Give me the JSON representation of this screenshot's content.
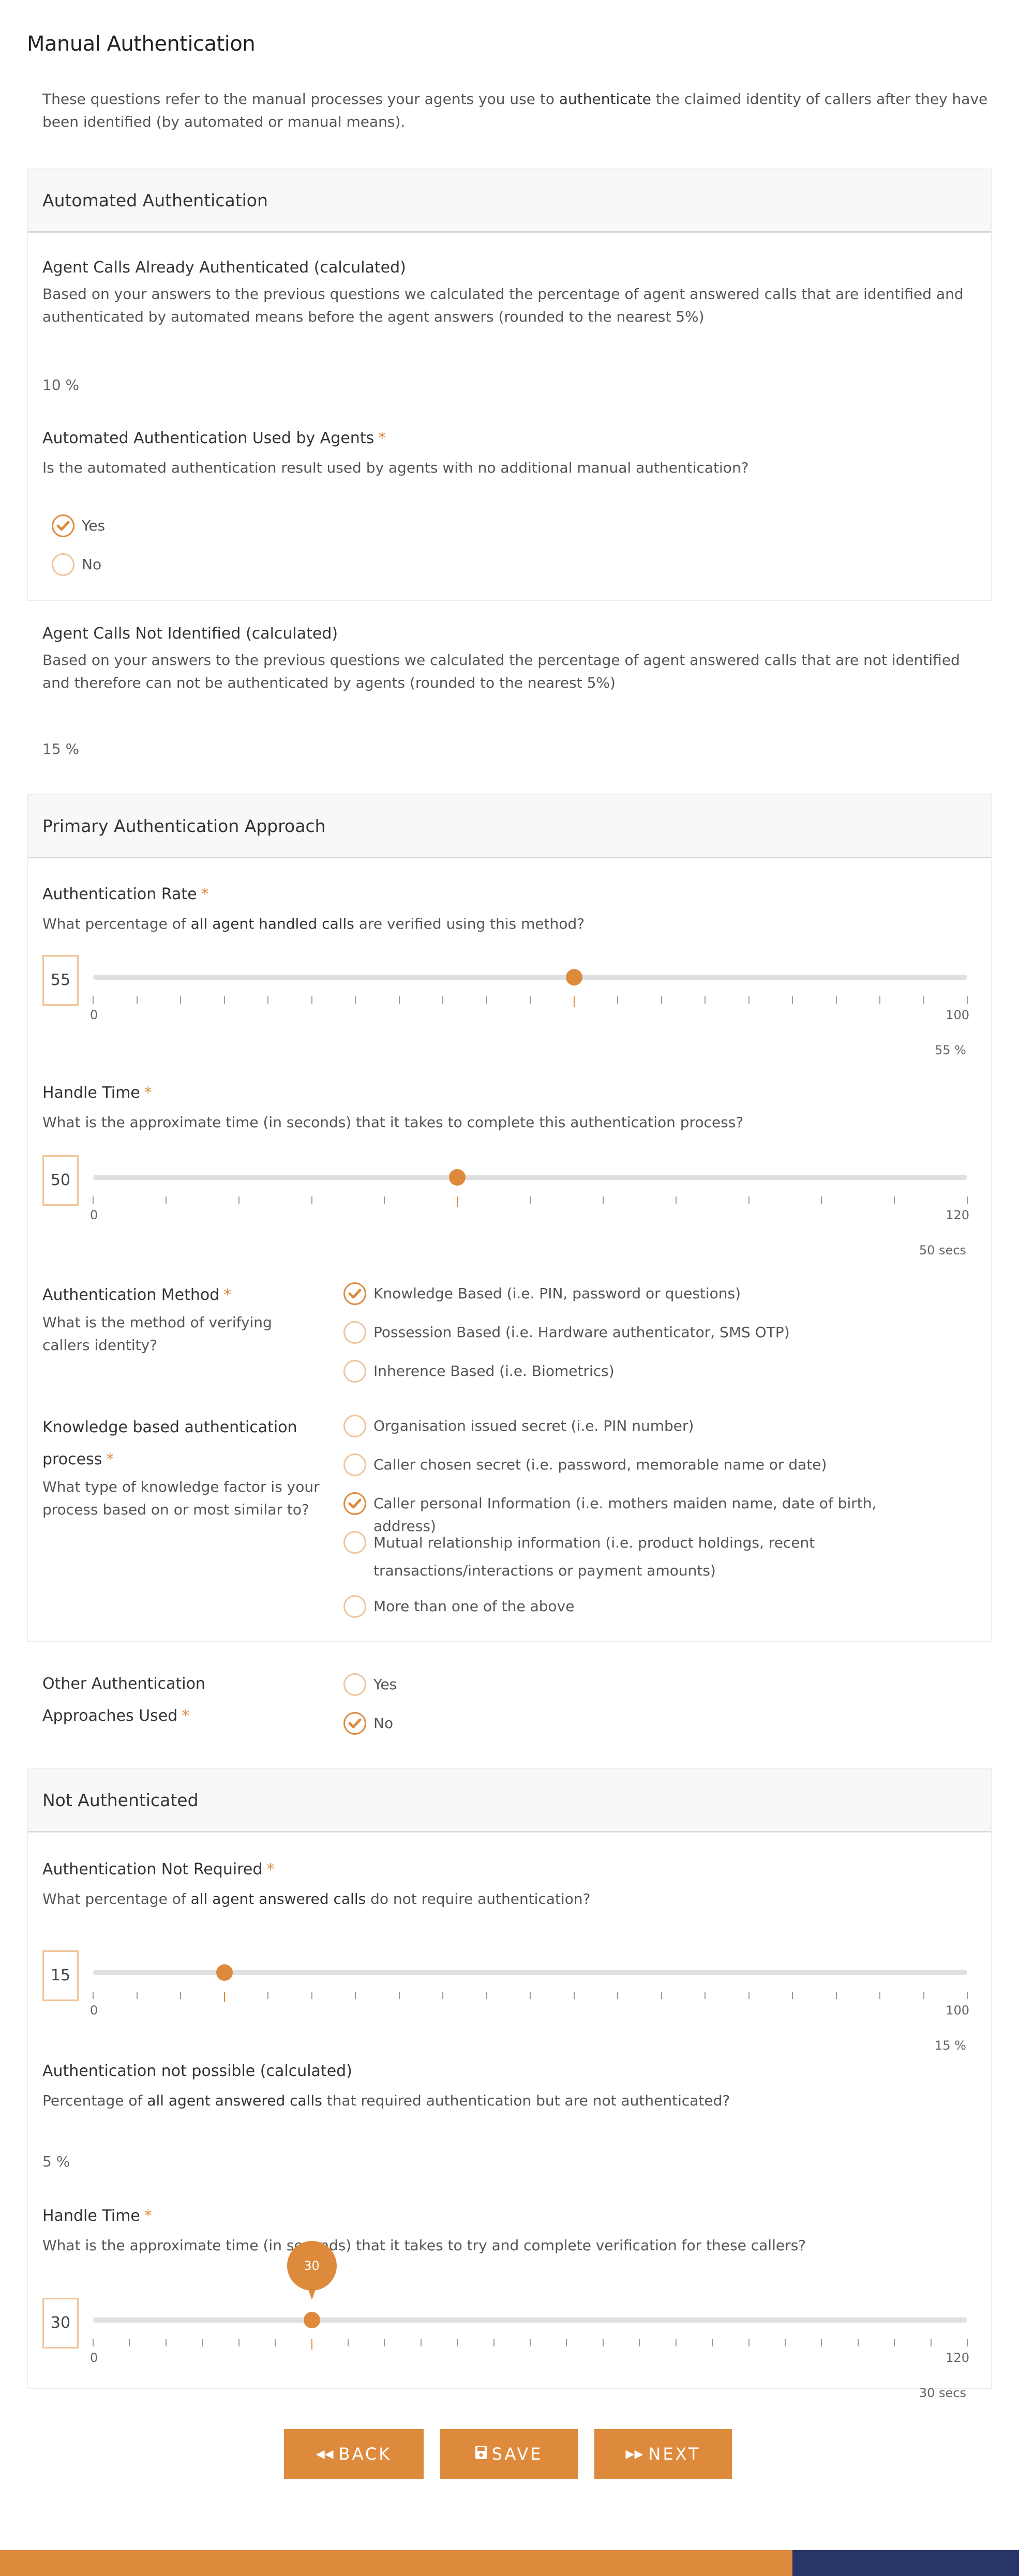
{
  "page": {
    "title": "Manual Authentication",
    "intro_pre": "These questions refer to the manual processes your agents you use to ",
    "intro_bold": "authenticate",
    "intro_post": " the claimed identity of callers after they have been identified (by automated or manual means)."
  },
  "colors": {
    "accent": "#de8a3c",
    "accent_light": "#f0c49a",
    "footer_navy": "#283568",
    "panel_header_bg": "#f8f8f8"
  },
  "automated": {
    "header": "Automated Authentication",
    "already_auth": {
      "title": "Agent Calls Already Authenticated (calculated)",
      "desc": "Based on your answers to the previous questions we calculated the percentage of agent answered calls that are identified and authenticated by automated means before the agent answers (rounded to the nearest 5%)",
      "value": "10 %"
    },
    "used_by_agents": {
      "title": "Automated Authentication Used by Agents",
      "required": "*",
      "desc": "Is the automated authentication result used by agents with no additional manual authentication?",
      "options": [
        {
          "label": "Yes",
          "checked": true
        },
        {
          "label": "No",
          "checked": false
        }
      ]
    }
  },
  "not_identified": {
    "title": "Agent Calls Not Identified (calculated)",
    "desc": "Based on your answers to the previous questions we calculated the percentage of agent answered calls that are not identified and therefore can not be authenticated by agents (rounded to the nearest 5%)",
    "value": "15 %"
  },
  "primary": {
    "header": "Primary Authentication Approach",
    "auth_rate": {
      "title": "Authentication Rate",
      "required": "*",
      "desc_pre": "What percentage of ",
      "desc_bold": "all agent handled calls",
      "desc_post": " are verified using this method?",
      "value": 55,
      "min": 0,
      "max": 100,
      "step": 5,
      "min_label": "0",
      "max_label": "100",
      "readout": "55 %"
    },
    "handle_time": {
      "title": "Handle Time",
      "required": "*",
      "desc": "What is the approximate time (in seconds) that it takes to complete this authentication process?",
      "value": 50,
      "min": 0,
      "max": 120,
      "step": 10,
      "min_label": "0",
      "max_label": "120",
      "readout": "50 secs"
    },
    "method": {
      "title": "Authentication Method",
      "required": "*",
      "desc": "What is the method of verifying callers identity?",
      "options": [
        {
          "label": "Knowledge Based (i.e. PIN, password or questions)",
          "checked": true
        },
        {
          "label": "Possession Based (i.e. Hardware authenticator, SMS OTP)",
          "checked": false
        },
        {
          "label": "Inherence Based (i.e. Biometrics)",
          "checked": false
        }
      ]
    },
    "knowledge_process": {
      "title": "Knowledge based authentication process",
      "required": "*",
      "desc": "What type of knowledge factor is your process based on or most similar to?",
      "options": [
        {
          "label": "Organisation issued secret (i.e. PIN number)",
          "checked": false
        },
        {
          "label": "Caller chosen secret (i.e. password, memorable name or date)",
          "checked": false
        },
        {
          "label": "Caller personal Information (i.e. mothers maiden name, date of birth, address)",
          "checked": true
        },
        {
          "label": "Mutual relationship information (i.e. product holdings, recent transactions/interactions or payment amounts)",
          "checked": false
        },
        {
          "label": "More than one of the above",
          "checked": false
        }
      ]
    }
  },
  "other_approaches": {
    "title": "Other Authentication Approaches Used",
    "required": "*",
    "options": [
      {
        "label": "Yes",
        "checked": false
      },
      {
        "label": "No",
        "checked": true
      }
    ]
  },
  "not_authenticated": {
    "header": "Not Authenticated",
    "not_required": {
      "title": "Authentication Not Required",
      "required": "*",
      "desc_pre": "What percentage of ",
      "desc_bold": "all agent answered calls",
      "desc_post": " do not require authentication?",
      "value": 15,
      "min": 0,
      "max": 100,
      "step": 5,
      "min_label": "0",
      "max_label": "100",
      "readout": "15 %"
    },
    "not_possible": {
      "title": "Authentication not possible (calculated)",
      "desc_pre": "Percentage of ",
      "desc_bold": "all agent answered calls",
      "desc_post": " that required authentication but are not authenticated?",
      "value": "5 %"
    },
    "handle_time": {
      "title": "Handle Time",
      "required": "*",
      "desc": "What is the approximate time (in seconds) that it takes to try and complete verification for these callers?",
      "value": 30,
      "min": 0,
      "max": 120,
      "step": 5,
      "min_label": "0",
      "max_label": "120",
      "readout": "30 secs",
      "tooltip": "30"
    }
  },
  "buttons": {
    "back": {
      "label": "BACK",
      "icon": "double-chevron-left-icon"
    },
    "save": {
      "label": "SAVE",
      "icon": "floppy-disk-icon"
    },
    "next": {
      "label": "NEXT",
      "icon": "double-chevron-right-icon"
    }
  }
}
